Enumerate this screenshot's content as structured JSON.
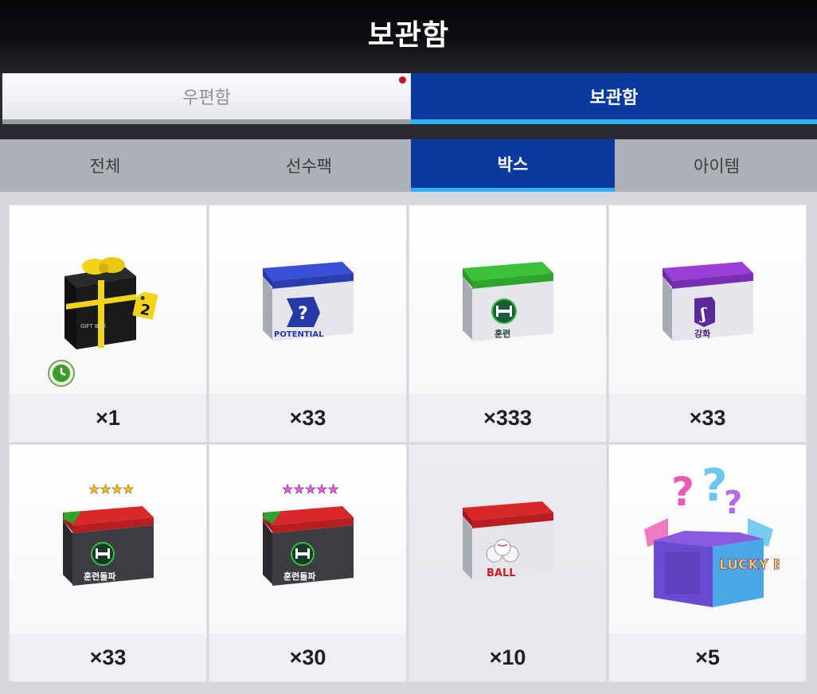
{
  "header": {
    "title": "보관함"
  },
  "main_tabs": [
    {
      "label": "우편함",
      "active": false,
      "has_notification": true
    },
    {
      "label": "보관함",
      "active": true
    }
  ],
  "sub_tabs": [
    {
      "label": "전체",
      "active": false
    },
    {
      "label": "선수팩",
      "active": false
    },
    {
      "label": "박스",
      "active": true
    },
    {
      "label": "아이템",
      "active": false
    }
  ],
  "items": [
    {
      "icon": "gift-box-icon",
      "count": "×1",
      "box_text": "GIFT BOX",
      "tag": "2",
      "timer_icon": "clock-icon"
    },
    {
      "icon": "potential-box-icon",
      "count": "×33",
      "box_text": "POTENTIAL",
      "lid_color": "#3a4fd8"
    },
    {
      "icon": "training-box-icon",
      "count": "×333",
      "box_text": "훈련",
      "lid_color": "#3cc23a"
    },
    {
      "icon": "enhance-box-icon",
      "count": "×33",
      "box_text": "강화",
      "lid_color": "#9a3fd6"
    },
    {
      "icon": "training-breakthrough-box-4star-icon",
      "count": "×33",
      "box_text": "훈련돌파",
      "stars": "★★★★",
      "star_color": "#f0c020"
    },
    {
      "icon": "training-breakthrough-box-5star-icon",
      "count": "×30",
      "box_text": "훈련돌파",
      "stars": "★★★★★",
      "star_color": "#e060e0"
    },
    {
      "icon": "ball-box-icon",
      "count": "×10",
      "box_text": "BALL",
      "lid_color": "#d9282a"
    },
    {
      "icon": "lucky-box-icon",
      "count": "×5",
      "box_text": "LUCKY BOX"
    }
  ],
  "colors": {
    "accent_blue": "#0a3aa0",
    "tab_underline": "#2eb1f0",
    "notification_red": "#c8102e"
  }
}
